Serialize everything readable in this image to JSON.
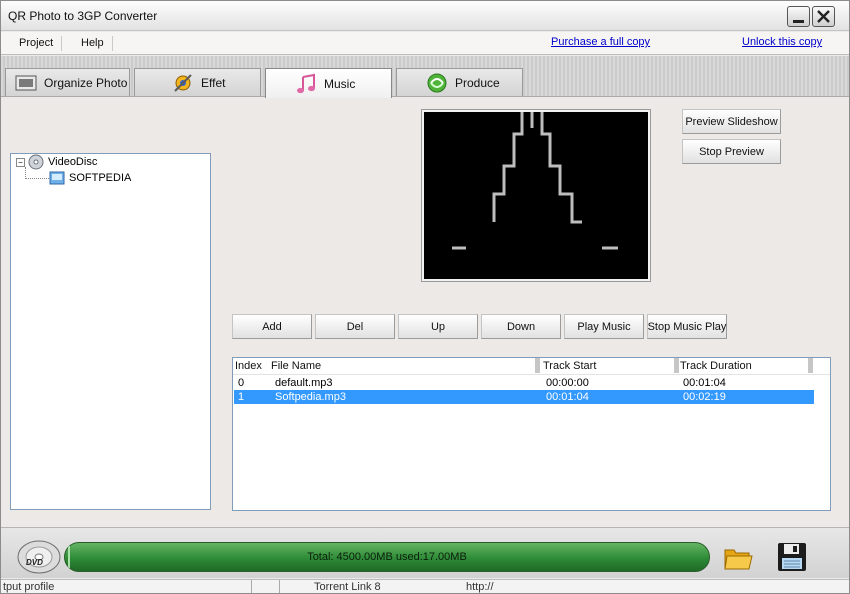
{
  "window": {
    "title": "QR Photo to 3GP Converter"
  },
  "menu": {
    "items": [
      "Project",
      "Help"
    ],
    "links": [
      "Purchase a full copy",
      "Unlock this copy"
    ]
  },
  "tabs": [
    {
      "label": "Organize Photo",
      "icon": "photo-icon"
    },
    {
      "label": "Effet",
      "icon": "effect-icon"
    },
    {
      "label": "Music",
      "icon": "music-note-icon",
      "active": true
    },
    {
      "label": "Produce",
      "icon": "produce-icon"
    }
  ],
  "tree": {
    "root": "VideoDisc",
    "child": "SOFTPEDIA"
  },
  "preview_buttons": {
    "preview": "Preview Slideshow",
    "stop": "Stop Preview"
  },
  "music_buttons": {
    "add": "Add",
    "del": "Del",
    "up": "Up",
    "down": "Down",
    "play": "Play Music",
    "stop": "Stop Music Play"
  },
  "track_list": {
    "columns": [
      "Index",
      "File Name",
      "Track Start",
      "Track Duration"
    ],
    "rows": [
      {
        "index": "0",
        "file": "default.mp3",
        "start": "00:00:00",
        "duration": "00:01:04"
      },
      {
        "index": "1",
        "file": "Softpedia.mp3",
        "start": "00:01:04",
        "duration": "00:02:19",
        "selected": true
      }
    ]
  },
  "capacity": {
    "disc_label": "DVD",
    "text": "Total: 4500.00MB used:17.00MB",
    "used_fraction": 0.0038
  },
  "statusbar": {
    "left": "tput profile",
    "middle": "Torrent Link  8",
    "right": "http://"
  },
  "colors": {
    "selection": "#3399ff",
    "progress": "#2e8b37",
    "link": "#0000cc"
  }
}
